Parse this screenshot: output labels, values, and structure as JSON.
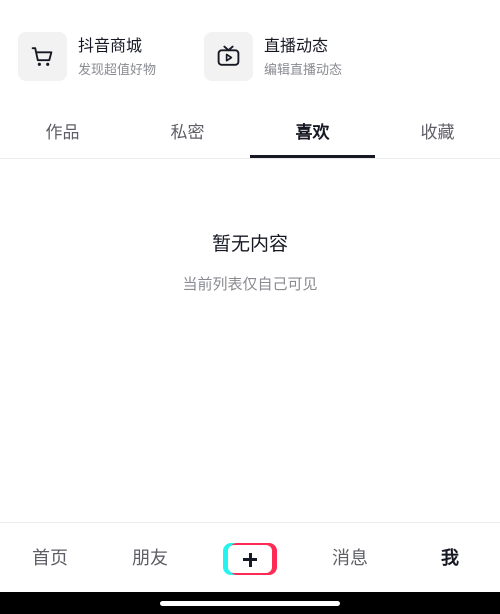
{
  "features": {
    "shop": {
      "title": "抖音商城",
      "subtitle": "发现超值好物",
      "icon": "shopping-cart-icon"
    },
    "live": {
      "title": "直播动态",
      "subtitle": "编辑直播动态",
      "icon": "tv-play-icon"
    }
  },
  "tabs": [
    {
      "label": "作品"
    },
    {
      "label": "私密"
    },
    {
      "label": "喜欢",
      "active": true
    },
    {
      "label": "收藏"
    }
  ],
  "empty_state": {
    "title": "暂无内容",
    "subtitle": "当前列表仅自己可见"
  },
  "bottom_nav": {
    "items": [
      {
        "label": "首页"
      },
      {
        "label": "朋友"
      },
      {
        "label": "消息"
      },
      {
        "label": "我",
        "active": true
      }
    ],
    "create_icon": "plus-icon"
  },
  "colors": {
    "text_primary": "#161823",
    "text_secondary": "#8a8b91",
    "brand_cyan": "#25f4ee",
    "brand_pink": "#fe2c55"
  }
}
